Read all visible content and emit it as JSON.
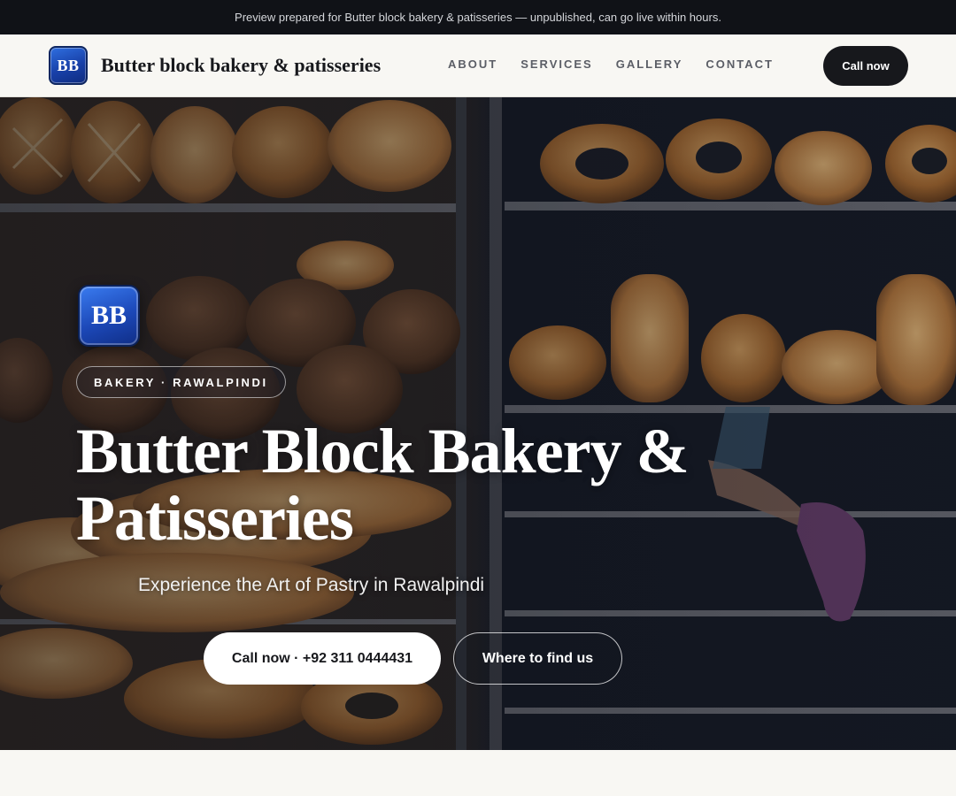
{
  "preview_bar": {
    "text": "Preview prepared for Butter block bakery & patisseries — unpublished, can go live within hours."
  },
  "header": {
    "logo_text": "BB",
    "brand_name": "Butter block bakery & patisseries",
    "nav": [
      "ABOUT",
      "SERVICES",
      "GALLERY",
      "CONTACT"
    ],
    "cta_label": "Call now"
  },
  "hero": {
    "logo_text": "BB",
    "tag": "BAKERY · RAWALPINDI",
    "title": "Butter Block Bakery & Patisseries",
    "subtitle": "Experience the Art of Pastry in Rawalpindi",
    "primary_button": "Call now · +92 311 0444431",
    "secondary_button": "Where to find us",
    "background_image": "bakery-display-shelves-photo"
  },
  "colors": {
    "dark": "#17181c",
    "preview_bar_bg": "#101217",
    "page_bg": "#f8f7f3",
    "logo_blue": "#1c48b8"
  }
}
